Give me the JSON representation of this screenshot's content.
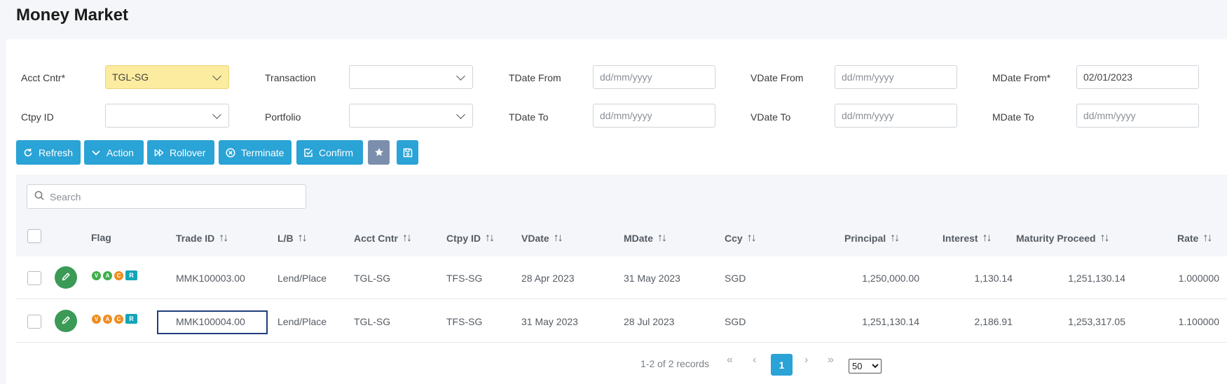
{
  "page": {
    "title": "Money Market"
  },
  "filters": {
    "acct_cntr": {
      "label": "Acct Cntr*",
      "value": "TGL-SG"
    },
    "transaction": {
      "label": "Transaction",
      "value": ""
    },
    "tdate_from": {
      "label": "TDate From",
      "placeholder": "dd/mm/yyyy"
    },
    "vdate_from": {
      "label": "VDate From",
      "placeholder": "dd/mm/yyyy"
    },
    "mdate_from": {
      "label": "MDate From*",
      "value": "02/01/2023"
    },
    "ctpy_id": {
      "label": "Ctpy ID",
      "value": ""
    },
    "portfolio": {
      "label": "Portfolio",
      "value": ""
    },
    "tdate_to": {
      "label": "TDate To",
      "placeholder": "dd/mm/yyyy"
    },
    "vdate_to": {
      "label": "VDate To",
      "placeholder": "dd/mm/yyyy"
    },
    "mdate_to": {
      "label": "MDate To",
      "placeholder": "dd/mm/yyyy"
    }
  },
  "toolbar": {
    "refresh": "Refresh",
    "action": "Action",
    "rollover": "Rollover",
    "terminate": "Terminate",
    "confirm": "Confirm"
  },
  "search": {
    "placeholder": "Search"
  },
  "table": {
    "headers": {
      "flag": "Flag",
      "trade_id": "Trade ID",
      "lb": "L/B",
      "acct_cntr": "Acct Cntr",
      "ctpy_id": "Ctpy ID",
      "vdate": "VDate",
      "mdate": "MDate",
      "ccy": "Ccy",
      "principal": "Principal",
      "interest": "Interest",
      "maturity": "Maturity Proceed",
      "rate": "Rate"
    },
    "rows": [
      {
        "flags": [
          {
            "text": "V",
            "color": "#3fae49"
          },
          {
            "text": "A",
            "color": "#3fae49"
          },
          {
            "text": "C",
            "color": "#f08c1e"
          },
          {
            "text": "R",
            "color": "#13a5b8"
          }
        ],
        "trade_id": "MMK100003.00",
        "lb": "Lend/Place",
        "acct_cntr": "TGL-SG",
        "ctpy_id": "TFS-SG",
        "vdate": "28 Apr 2023",
        "mdate": "31 May 2023",
        "ccy": "SGD",
        "principal": "1,250,000.00",
        "interest": "1,130.14",
        "maturity": "1,251,130.14",
        "rate": "1.000000"
      },
      {
        "flags": [
          {
            "text": "V",
            "color": "#f08c1e"
          },
          {
            "text": "A",
            "color": "#f08c1e"
          },
          {
            "text": "C",
            "color": "#f08c1e"
          },
          {
            "text": "R",
            "color": "#13a5b8"
          }
        ],
        "trade_id": "MMK100004.00",
        "lb": "Lend/Place",
        "acct_cntr": "TGL-SG",
        "ctpy_id": "TFS-SG",
        "vdate": "31 May 2023",
        "mdate": "28 Jul 2023",
        "ccy": "SGD",
        "principal": "1,251,130.14",
        "interest": "2,186.91",
        "maturity": "1,253,317.05",
        "rate": "1.100000"
      }
    ]
  },
  "pagination": {
    "summary": "1-2 of 2 records",
    "current_page": "1",
    "page_size": "50"
  },
  "colors": {
    "accent": "#2aa3d6",
    "edit": "#3a9a56",
    "highlight": "#fcec9f",
    "selected_border": "#1f3f7a"
  }
}
